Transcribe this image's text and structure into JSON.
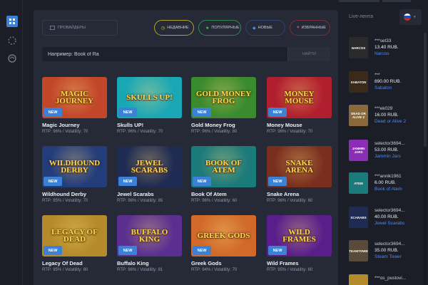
{
  "rail": {
    "icons": [
      "games-grid-icon",
      "spinner-icon",
      "history-icon"
    ]
  },
  "filters": {
    "providers_label": "ПРОВАЙДЕРЫ",
    "chips": [
      {
        "label": "НЕДАВНИЕ",
        "glyph": "◷"
      },
      {
        "label": "ПОПУЛЯРНЫЕ",
        "glyph": "★"
      },
      {
        "label": "НОВЫЕ",
        "glyph": "◆"
      },
      {
        "label": "ИЗБРАННЫЕ",
        "glyph": "♥"
      }
    ]
  },
  "search": {
    "placeholder": "Например: Book of Ra",
    "button": "НАЙТИ"
  },
  "games": [
    {
      "name": "Magic Journey",
      "meta": "RTP: 96% / Volatility: 70",
      "badge": "NEW",
      "art": "MAGIC JOURNEY",
      "bg": "#c2462a"
    },
    {
      "name": "Skulls UP!",
      "meta": "RTP: 96% / Volatility: 70",
      "badge": "NEW",
      "art": "SKULLS UP!",
      "bg": "#1aa7b5"
    },
    {
      "name": "Gold Money Frog",
      "meta": "RTP: 96% / Volatility: 80",
      "badge": "NEW",
      "art": "GOLD MONEY FROG",
      "bg": "#3a8a2e"
    },
    {
      "name": "Money Mouse",
      "meta": "RTP: 96% / Volatility: 70",
      "badge": "NEW",
      "art": "MONEY MOUSE",
      "bg": "#b01f2e"
    },
    {
      "name": "Wildhound Derby",
      "meta": "RTP: 95% / Volatility: 70",
      "badge": "NEW",
      "art": "WILDHOUND DERBY",
      "bg": "#233c7a"
    },
    {
      "name": "Jewel Scarabs",
      "meta": "RTP: 96% / Volatility: 85",
      "badge": "NEW",
      "art": "JEWEL SCARABS",
      "bg": "#1f2b52"
    },
    {
      "name": "Book Of Atem",
      "meta": "RTP: 96% / Volatility: 60",
      "badge": "NEW",
      "art": "BOOK OF ATEM",
      "bg": "#1b7a7a"
    },
    {
      "name": "Snake Arena",
      "meta": "RTP: 96% / Volatility: 60",
      "badge": "NEW",
      "art": "SNAKE ARENA",
      "bg": "#7a2f1e"
    },
    {
      "name": "Legacy Of Dead",
      "meta": "RTP: 95% / Volatility: 80",
      "badge": "NEW",
      "art": "LEGACY OF DEAD",
      "bg": "#b58a2a"
    },
    {
      "name": "Buffalo King",
      "meta": "RTP: 96% / Volatility: 81",
      "badge": "NEW",
      "art": "BUFFALO KING",
      "bg": "#5a2f8f"
    },
    {
      "name": "Greek Gods",
      "meta": "RTP: 94% / Volatility: 70",
      "badge": "NEW",
      "art": "GREEK GODS",
      "bg": "#d0692a"
    },
    {
      "name": "Wild Frames",
      "meta": "RTP: 95% / Volatility: 60",
      "badge": "NEW",
      "art": "WILD FRAMES",
      "bg": "#5a1e8a"
    }
  ],
  "feed": {
    "title": "Live-лента",
    "flag": [
      "#ffffff",
      "#1e4fb5",
      "#d52b1e"
    ],
    "items": [
      {
        "user": "***set33",
        "amount": "13.40 RUB.",
        "game": "Narcos",
        "art": "NARCOS",
        "bg": "#2a2a2a"
      },
      {
        "user": "***",
        "amount": "890.00 RUB.",
        "game": "Sabaton",
        "art": "SABATON",
        "bg": "#3a2a1a"
      },
      {
        "user": "***ek029",
        "amount": "16.00 RUB.",
        "game": "Dead or Alive 2",
        "art": "DEAD OR ALIVE 2",
        "bg": "#8a6a3a"
      },
      {
        "user": "selector3694...",
        "amount": "53.00 RUB.",
        "game": "Jammin Jars",
        "art": "JAMMIN JARS",
        "bg": "#8a2fb5"
      },
      {
        "user": "***annik1961",
        "amount": "6.00 RUB.",
        "game": "Book of Atem",
        "art": "ATEM",
        "bg": "#1b7a7a"
      },
      {
        "user": "selector3694...",
        "amount": "40.00 RUB.",
        "game": "Jewel Scarabs",
        "art": "SCARABS",
        "bg": "#1f2b52"
      },
      {
        "user": "selector3694...",
        "amount": "35.00 RUB.",
        "game": "Steam Tower",
        "art": "STEAMTOWER",
        "bg": "#5a4a3a"
      },
      {
        "user": "***os_pustovi...",
        "amount": "",
        "game": "",
        "art": "",
        "bg": "#b58a2a"
      }
    ]
  }
}
